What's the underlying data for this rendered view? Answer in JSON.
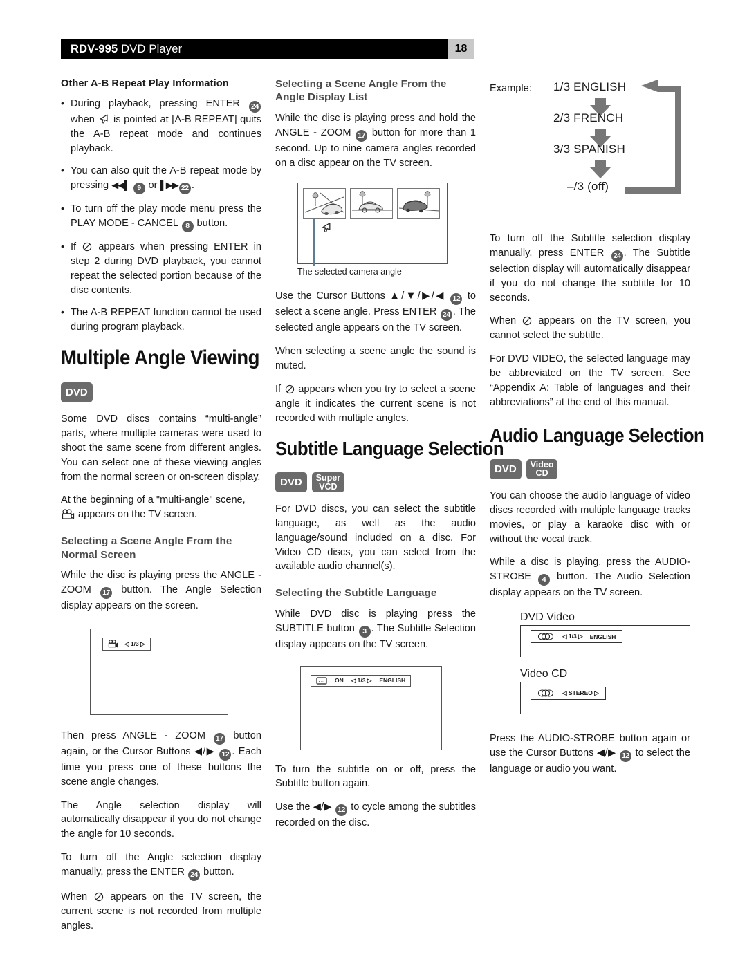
{
  "header": {
    "model": "RDV-995",
    "product": " DVD Player",
    "page_number": "18"
  },
  "col1": {
    "heading_ab": "Other A-B Repeat Play Information",
    "bullets": [
      {
        "pre": "During playback, pressing ENTER ",
        "badge": "24",
        "mid": " when ",
        "icon": "cursor-arrow-icon",
        "post": " is pointed at [A-B REPEAT] quits the A-B repeat mode and continues playback."
      },
      {
        "pre": "You can also quit the A-B repeat mode by pressing ",
        "icon1": "prev-track-icon",
        "badge": "9",
        "mid": " or ",
        "icon2": "next-track-icon",
        "badge2": "22",
        "post": "."
      },
      {
        "pre": "To turn off the play mode menu press the PLAY MODE - CANCEL ",
        "badge": "8",
        "post": " button."
      },
      {
        "pre": "If ",
        "icon": "prohibited-icon",
        "mid": " appears when pressing ENTER in step 2 during DVD playback, you cannot repeat the selected portion because of the disc contents."
      },
      {
        "pre": "The A-B REPEAT function cannot be used during program playback."
      }
    ],
    "title_multiple_angle": "Multiple Angle Viewing",
    "disc_badges": [
      "DVD"
    ],
    "para1": "Some DVD discs contains “multi-angle” parts, where multiple cameras were used to shoot the same scene from different angles. You can select one of these viewing angles from the normal screen or on-screen display.",
    "para2_pre": "At the beginning of a \"multi-angle\" scene, ",
    "para2_icon": "camera-icon",
    "para2_post": " appears on the TV screen.",
    "sub_normal_screen": "Selecting a Scene Angle From the Normal Screen",
    "para3_pre": "While the disc is playing press the ANGLE - ZOOM ",
    "para3_badge": "17",
    "para3_post": " button. The Angle Selection display appears on the screen.",
    "osd_angle": {
      "icon": "camera-icon",
      "value": "◁ 1/3 ▷"
    },
    "para4_pre": "Then press ANGLE - ZOOM ",
    "para4_badge": "17",
    "para4_mid": " button again, or the Cursor Buttons ◀/▶ ",
    "para4_badge2": "12",
    "para4_post": ". Each time you press one of these buttons the scene angle changes.",
    "para5": "The Angle selection display will automatically disappear if you do not change the angle for 10 seconds.",
    "para6_pre": "To turn off the Angle selection display manually, press the ENTER ",
    "para6_badge": "24",
    "para6_post": " button.",
    "para7_pre": "When ",
    "para7_icon": "prohibited-icon",
    "para7_post": " appears on the TV screen, the current scene is not recorded from multiple angles."
  },
  "col2": {
    "sub_angle_display_list": "Selecting a Scene Angle From the Angle Display List",
    "para1_pre": "While the disc is playing press and hold the ANGLE - ZOOM ",
    "para1_badge": "17",
    "para1_post": " button for more than 1 second. Up to nine camera angles recorded on a disc appear on the TV screen.",
    "figure_caption": "The selected camera angle",
    "thumbnails": [
      "angled-car-thumbnail",
      "side-car-thumbnail",
      "rear-car-thumbnail"
    ],
    "para2_pre": "Use the Cursor Buttons ▲/▼/▶/◀ ",
    "para2_badge": "12",
    "para2_mid": " to select a scene angle. Press ENTER ",
    "para2_badge2": "24",
    "para2_post": ". The selected angle appears on the TV screen.",
    "para3": "When selecting a scene angle the sound is muted.",
    "para4_pre": "If ",
    "para4_icon": "prohibited-icon",
    "para4_post": " appears when you try to select a scene angle it indicates the current scene is not recorded with multiple angles.",
    "title_subtitle": "Subtitle Language Selection",
    "disc_badges": [
      "DVD",
      "Super VCD"
    ],
    "para5": "For DVD discs, you can select the subtitle language, as well as the audio language/sound included on a disc. For Video CD discs, you can select from the available audio channel(s).",
    "sub_selecting_subtitle": "Selecting the Subtitle Language",
    "para6_pre": "While DVD disc is playing press the SUBTITLE button ",
    "para6_badge": "3",
    "para6_post": ". The Subtitle Selection display appears on the TV screen.",
    "osd_subtitle": {
      "icon": "subtitle-icon",
      "state": "ON",
      "value": "◁ 1/3 ▷",
      "language": "ENGLISH"
    },
    "para7": "To turn the subtitle on or off, press the Subtitle button again.",
    "para8_pre": "Use the ◀/▶ ",
    "para8_badge": "12",
    "para8_post": " to cycle among the subtitles recorded on the disc."
  },
  "col3": {
    "example_label": "Example:",
    "flow_steps": [
      "1/3 ENGLISH",
      "2/3 FRENCH",
      "3/3 SPANISH",
      "–/3 (off)"
    ],
    "para1_pre": "To turn off the Subtitle selection display manually, press ENTER ",
    "para1_badge": "24",
    "para1_post": ". The Subtitle selection display will automatically disappear if you do not change the subtitle for 10 seconds.",
    "para2_pre": "When ",
    "para2_icon": "prohibited-icon",
    "para2_post": " appears on the TV screen, you cannot select the subtitle.",
    "para3": "For DVD VIDEO, the selected language may be abbreviated on the TV screen. See “Appendix A: Table of languages and their abbreviations” at the end of this manual.",
    "title_audio": "Audio Language Selection",
    "disc_badges": [
      "DVD",
      "Video CD"
    ],
    "para4": "You can choose the audio language of video discs recorded with multiple language tracks movies, or play a karaoke disc with or without the vocal track.",
    "para5_pre": "While a disc is playing, press the AUDIO-STROBE ",
    "para5_badge": "4",
    "para5_post": " button. The Audio Selection display appears on the TV screen.",
    "dvd_video_label": "DVD Video",
    "osd_dvd_video": {
      "icon": "audio-icon",
      "value": "◁ 1/3 ▷",
      "language": "ENGLISH"
    },
    "video_cd_label": "Video CD",
    "osd_video_cd": {
      "icon": "audio-icon",
      "value": "◁ STEREO ▷"
    },
    "para6_pre": "Press the AUDIO-STROBE button again or use the Cursor Buttons ◀/▶ ",
    "para6_badge": "12",
    "para6_post": " to select the language or audio you want."
  },
  "colors": {
    "header_bg": "#000000",
    "page_badge_bg": "#c9c9c9",
    "badge_gray": "#5c5c5c",
    "disc_badge_gray": "#6b6b6b",
    "subhead_gray": "#4a4a4a",
    "flow_arrow_gray": "#777777"
  }
}
